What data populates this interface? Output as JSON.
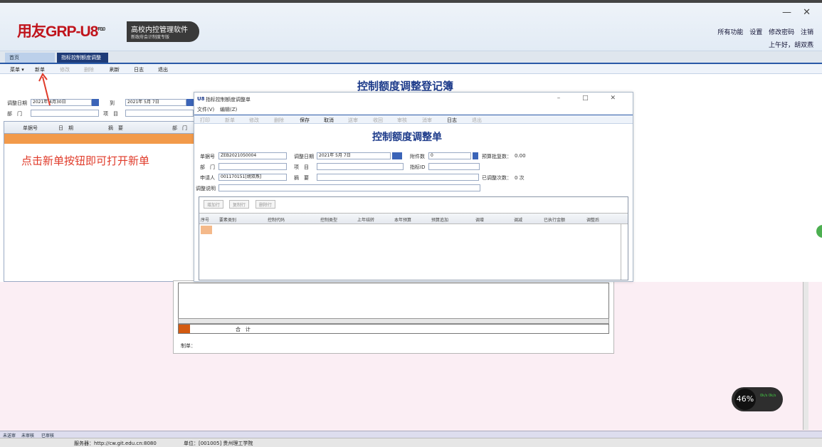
{
  "app": {
    "logo_text": "用友GRP-U8",
    "logo_sup": "R10",
    "product_name": "高校内控管理软件",
    "product_sub": "新政府会计制度专版",
    "window_controls": "— ✕"
  },
  "header": {
    "links": [
      "所有功能",
      "设置",
      "修改密码",
      "注销"
    ],
    "greeting": "上午好，胡双燕"
  },
  "tabs": [
    {
      "label": "首页"
    },
    {
      "label": "指标控制额度调整"
    }
  ],
  "toolbar": {
    "menu": "菜单 ▾",
    "new": "新单",
    "modify": "修改",
    "delete": "删除",
    "refresh": "刷新",
    "log": "日志",
    "exit": "退出"
  },
  "main": {
    "title": "控制额度调整登记簿",
    "filter": {
      "date_label": "调整日期",
      "date_from": "2021年 4月30日",
      "to_label": "到",
      "date_to": "2021年 5月 7日",
      "dept_label": "部　门",
      "item_label": "项　目"
    },
    "columns": [
      "单据号",
      "日　期",
      "摘　要",
      "部　门"
    ],
    "hint": "点击新单按钮即可打开新单"
  },
  "dialog": {
    "title": "指标控制额度调整单",
    "menu": [
      "文件(V)",
      "编辑(Z)"
    ],
    "toolbar": [
      "打印",
      "新单",
      "修改",
      "删除",
      "保存",
      "取消",
      "送审",
      "收回",
      "审核",
      "消审",
      "日志",
      "退出"
    ],
    "heading": "控制额度调整单",
    "fields": {
      "doc_no_label": "单据号",
      "doc_no": "ZEB2021050004",
      "date_label": "调整日期",
      "date": "2021年 5月 7日",
      "attach_label": "附件数",
      "attach": "0",
      "budget_label": "预算批复数：",
      "budget_value": "0.00",
      "dept_label": "部　门",
      "item_label": "项　目",
      "indicator_label": "指标ID",
      "applicant_label": "申请人",
      "applicant": "001170151[胡双燕]",
      "summary_label": "摘　要",
      "adjusted_label": "已调整次数：",
      "adjusted_value": "0 次",
      "note_label": "调整说明"
    },
    "row_buttons": [
      "增加行",
      "复制行",
      "删除行"
    ],
    "columns": [
      "序号",
      "要素类别",
      "控制代码",
      "控制类型",
      "上年结转",
      "本年预算",
      "预算追加",
      "调增",
      "调减",
      "已执行金额",
      "调整后"
    ]
  },
  "back_dialog": {
    "total": "合　计",
    "maker": "制单："
  },
  "speed": {
    "percent": "46%",
    "info": "0k/s 0k/s"
  },
  "bottom_tabs": [
    "未送审",
    "未审核",
    "已审核"
  ],
  "status": {
    "server": "服务器：http://cw.git.edu.cn:8080",
    "unit": "单位：[001005] 贵州理工学院"
  }
}
